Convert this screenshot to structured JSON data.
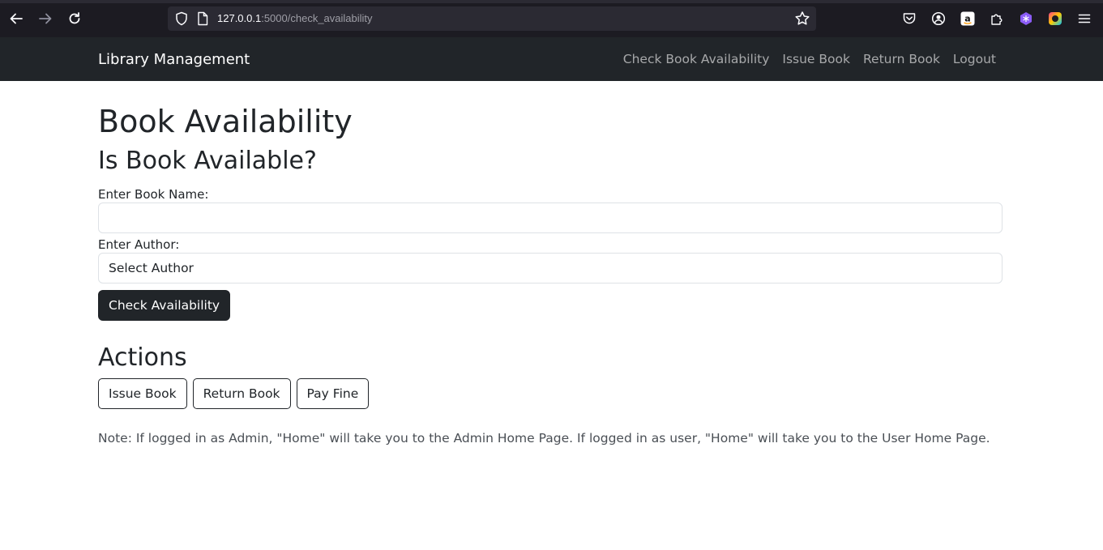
{
  "browser": {
    "url_host": "127.0.0.1",
    "url_rest": ":5000/check_availability"
  },
  "navbar": {
    "brand": "Library Management",
    "links": [
      "Check Book Availability",
      "Issue Book",
      "Return Book",
      "Logout"
    ]
  },
  "main": {
    "title": "Book Availability",
    "subtitle": "Is Book Available?",
    "book_label": "Enter Book Name:",
    "book_value": "",
    "author_label": "Enter Author:",
    "author_selected": "Select Author",
    "submit_label": "Check Availability",
    "actions_title": "Actions",
    "action_buttons": [
      "Issue Book",
      "Return Book",
      "Pay Fine"
    ],
    "note": "Note: If logged in as Admin, \"Home\" will take you to the Admin Home Page. If logged in as user, \"Home\" will take you to the User Home Page."
  },
  "colors": {
    "navbar_bg": "#212529",
    "browser_bg": "#1c1b22",
    "button_dark": "#212529"
  }
}
